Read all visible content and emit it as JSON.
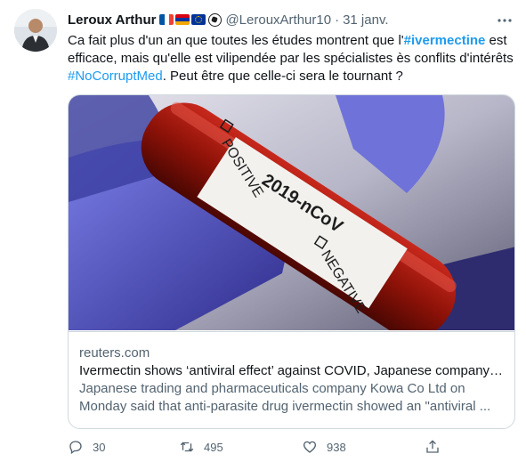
{
  "tweet": {
    "author_name": "Leroux Arthur",
    "handle": "@LerouxArthur10",
    "separator": "·",
    "date": "31 janv.",
    "text_part1": "Ca fait plus d'un an que toutes les études montrent que l'",
    "hashtag1": "#ivermectine",
    "text_part2": " est efficace, mais qu'elle est vilipendée par les spécialistes ès conflits d'intérêts ",
    "hashtag2": "#NoCorruptMed",
    "text_part3": ". Peut être que celle-ci sera le tournant ?",
    "flags": [
      "france-flag",
      "armenia-flag",
      "eu-flag",
      "soccer-ball"
    ]
  },
  "card": {
    "domain": "reuters.com",
    "title": "Ivermectin shows ‘antiviral effect’ against COVID, Japanese company ...",
    "desc_line1": "Japanese trading and pharmaceuticals company Kowa Co Ltd on",
    "desc_line2": "Monday said that anti-parasite drug ivermectin showed an \"antiviral ...",
    "image_labels": {
      "main": "2019-nCoV",
      "positive": "POSITIVE",
      "negative": "NEGATIVE"
    }
  },
  "actions": {
    "replies": "30",
    "retweets": "495",
    "likes": "938"
  },
  "colors": {
    "accent": "#1d9bf0",
    "text": "#0f1419",
    "secondary": "#536471",
    "border": "#cfd9de"
  }
}
